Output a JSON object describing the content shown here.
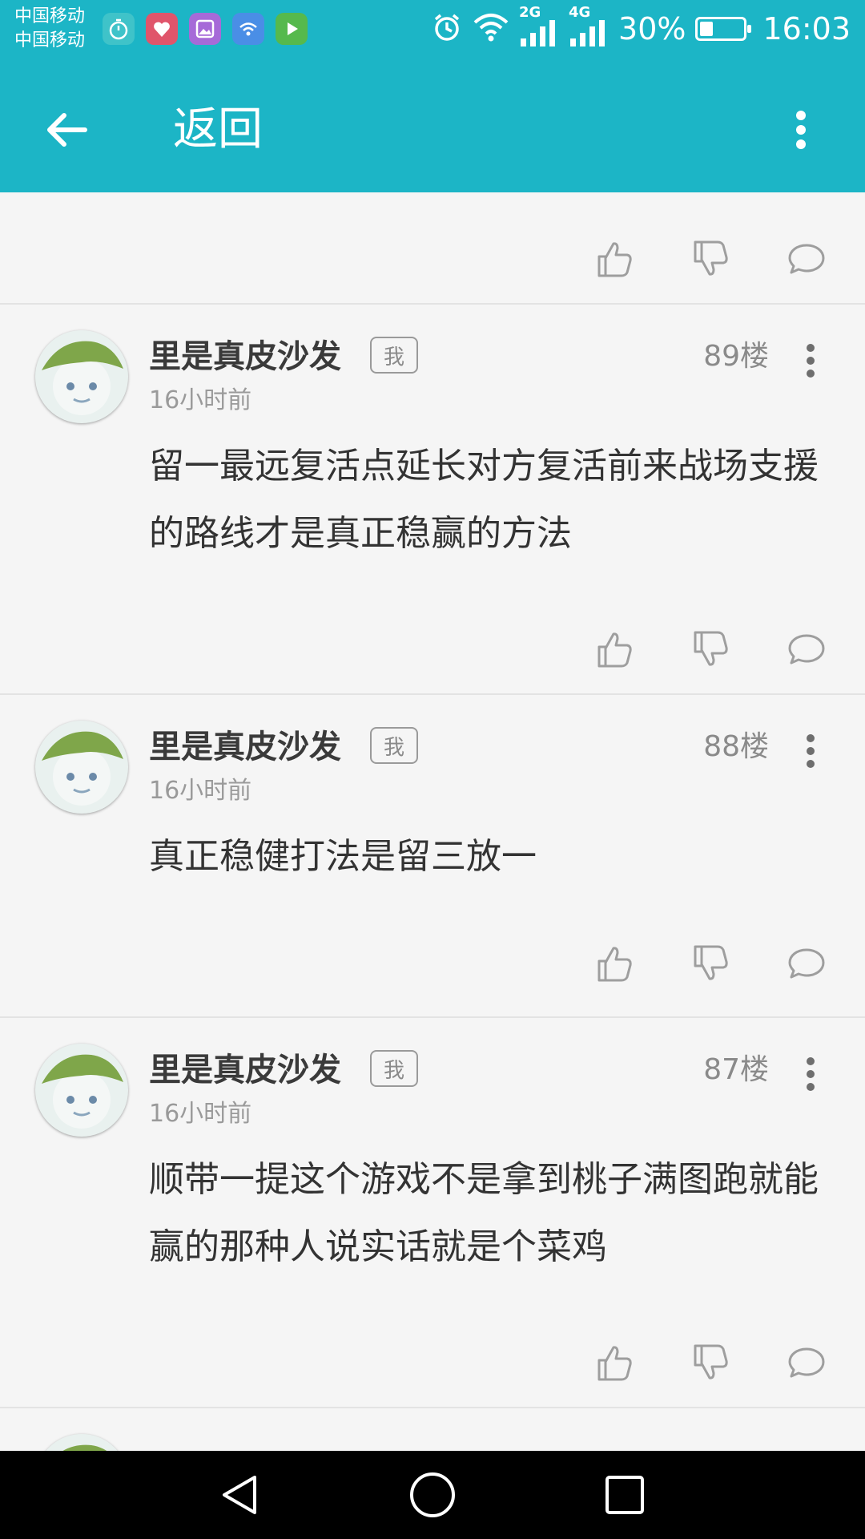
{
  "status_bar": {
    "carrier_1": "中国移动",
    "carrier_2": "中国移动",
    "notification_icons": [
      "stopwatch-icon",
      "health-app-icon",
      "gallery-app-icon",
      "wifi-app-icon",
      "video-play-app-icon"
    ],
    "net_label_1": "2G",
    "net_label_2": "4G",
    "battery_percent": "30%",
    "battery_level": 0.3,
    "time": "16:03"
  },
  "app_bar": {
    "title": "返回",
    "background": "#1cb5c6"
  },
  "comments": [
    {
      "username": "里是真皮沙发",
      "tag": "我",
      "floor": "89楼",
      "time": "16小时前",
      "content": "留一最远复活点延长对方复活前来战场支援的路线才是真正稳赢的方法"
    },
    {
      "username": "里是真皮沙发",
      "tag": "我",
      "floor": "88楼",
      "time": "16小时前",
      "content": "真正稳健打法是留三放一"
    },
    {
      "username": "里是真皮沙发",
      "tag": "我",
      "floor": "87楼",
      "time": "16小时前",
      "content": "顺带一提这个游戏不是拿到桃子满图跑就能赢的那种人说实话就是个菜鸡"
    }
  ],
  "colors": {
    "accent": "#1cb5c6",
    "icon_gray": "#9e9e9e",
    "text_dark": "#333333",
    "text_muted": "#8a8a8a"
  }
}
